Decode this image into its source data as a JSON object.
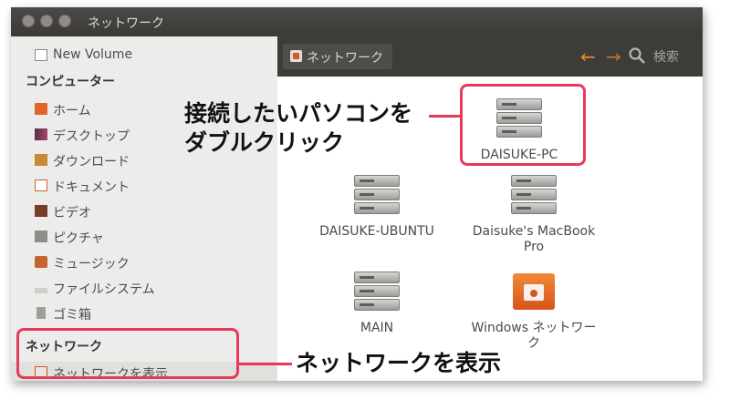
{
  "window": {
    "title": "ネットワーク"
  },
  "sidebar": {
    "new_volume": "New Volume",
    "computer_heading": "コンピューター",
    "items": [
      {
        "label": "ホーム"
      },
      {
        "label": "デスクトップ"
      },
      {
        "label": "ダウンロード"
      },
      {
        "label": "ドキュメント"
      },
      {
        "label": "ビデオ"
      },
      {
        "label": "ピクチャ"
      },
      {
        "label": "ミュージック"
      },
      {
        "label": "ファイルシステム"
      },
      {
        "label": "ゴミ箱"
      }
    ],
    "network_heading": "ネットワーク",
    "browse_network": "ネットワークを表示"
  },
  "toolbar": {
    "location": "ネットワーク",
    "back_icon": "back-arrow-icon",
    "forward_icon": "forward-arrow-icon",
    "search_label": "検索"
  },
  "content": {
    "items": [
      {
        "name": "DAISUKE-PC",
        "icon": "server-icon"
      },
      {
        "name": "DAISUKE-UBUNTU",
        "icon": "server-icon"
      },
      {
        "name": "Daisuke's MacBook Pro",
        "icon": "server-icon"
      },
      {
        "name": "MAIN",
        "icon": "server-icon"
      },
      {
        "name": "Windows ネットワーク",
        "icon": "windows-network-icon"
      }
    ]
  },
  "annotations": {
    "double_click_line1": "接続したいパソコンを",
    "double_click_line2": "ダブルクリック",
    "show_network": "ネットワークを表示",
    "color": "#e8395b"
  }
}
